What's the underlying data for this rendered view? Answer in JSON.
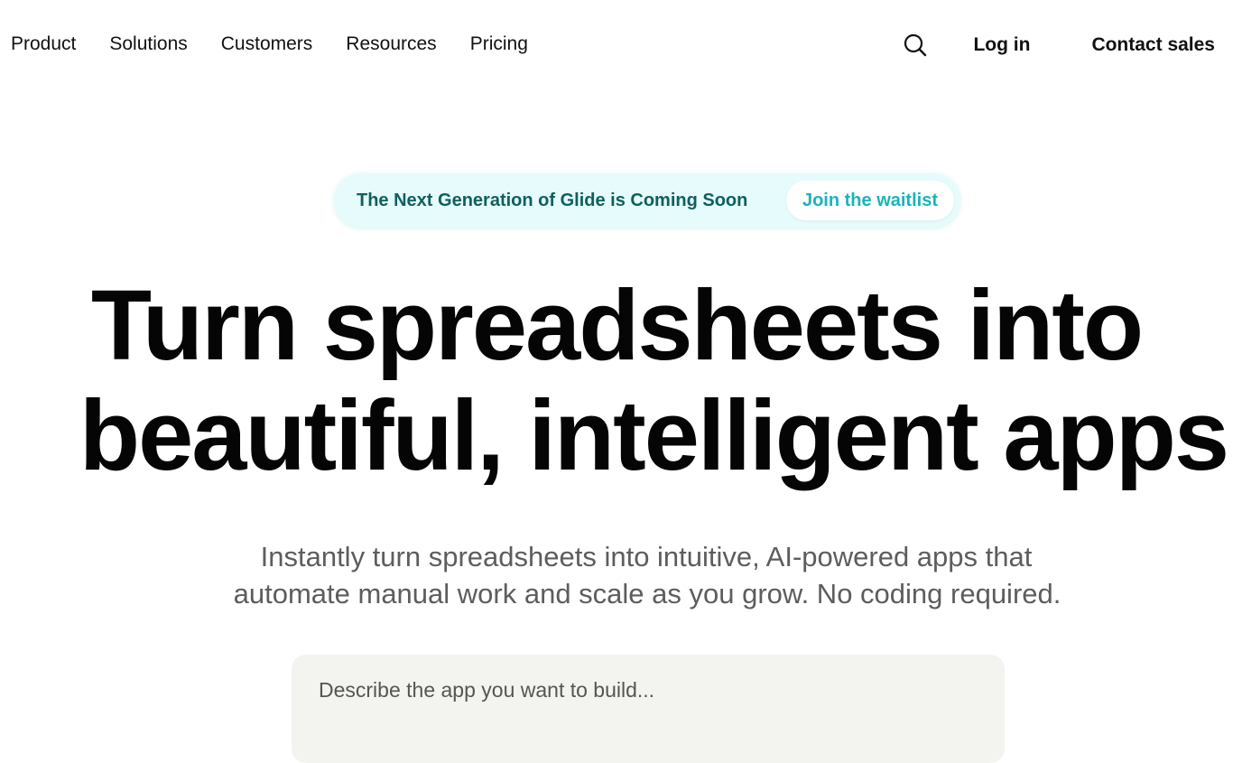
{
  "nav": {
    "items": [
      {
        "label": "Product"
      },
      {
        "label": "Solutions"
      },
      {
        "label": "Customers"
      },
      {
        "label": "Resources"
      },
      {
        "label": "Pricing"
      }
    ],
    "search_icon": "search-icon",
    "login_label": "Log in",
    "contact_label": "Contact sales"
  },
  "announcement": {
    "text": "The Next Generation of Glide is Coming Soon",
    "button_label": "Join the waitlist"
  },
  "hero": {
    "title_line_1": "Turn spreadsheets into",
    "title_line_2": "beautiful, intelligent apps",
    "subtitle_line_1": "Instantly turn spreadsheets into intuitive, AI-powered apps that",
    "subtitle_line_2": "automate manual work and scale as you grow. No coding required."
  },
  "prompt": {
    "placeholder": "Describe the app you want to build..."
  },
  "colors": {
    "accent_teal": "#1ab3bd",
    "announce_bg": "#e6fbfb",
    "announce_text": "#0f5f5f",
    "prompt_bg": "#f3f3ef"
  }
}
